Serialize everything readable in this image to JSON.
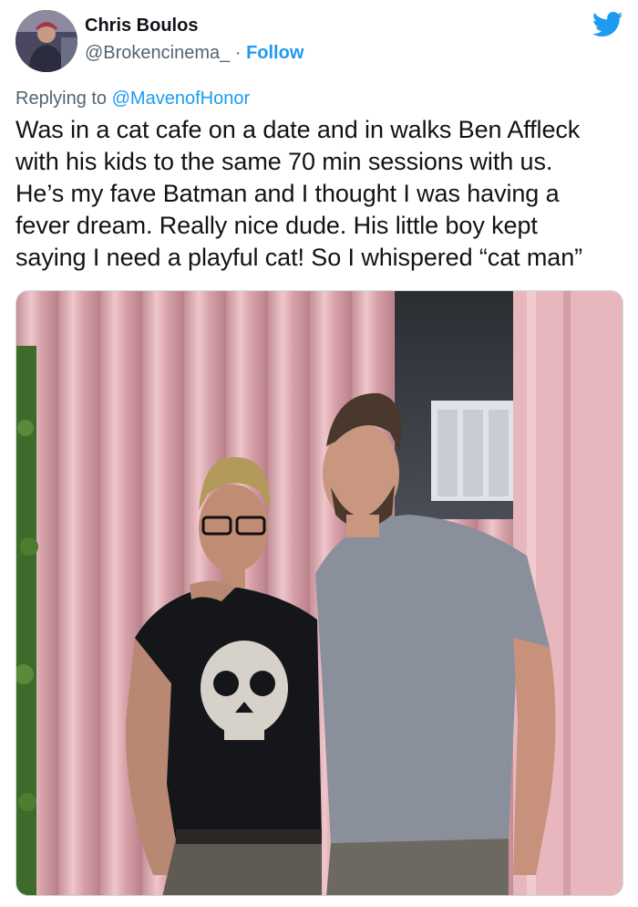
{
  "author": {
    "display_name": "Chris Boulos",
    "handle": "@Brokencinema_",
    "separator": " · ",
    "follow_label": "Follow",
    "avatar_icon": "user-avatar"
  },
  "brand": {
    "logo_icon": "twitter-bird-icon",
    "color": "#1d9bf0"
  },
  "reply": {
    "prefix": "Replying to ",
    "mention": "@MavenofHonor"
  },
  "tweet": {
    "text": "Was in a cat cafe on a date and in walks Ben Affleck\nwith his kids to the same 70 min sessions with us.\nHe’s my fave Batman and I thought I was having a\nfever dream. Really nice dude. His little boy kept\nsaying I need a playful cat! So I whispered “cat man”"
  },
  "media": {
    "type": "photo",
    "subject": "two men posing in front of a pink curtain"
  },
  "colors": {
    "text": "#0f1419",
    "secondary": "#536471",
    "link": "#1d9bf0",
    "curtain": "#d9a7ae"
  }
}
